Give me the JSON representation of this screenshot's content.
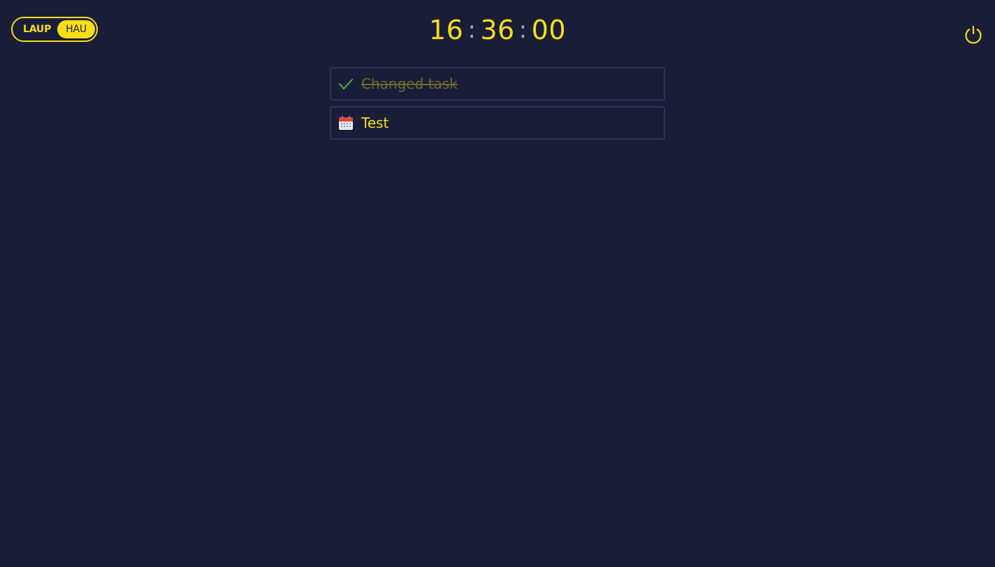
{
  "mode_toggle": {
    "options": [
      {
        "label": "LAUP",
        "active": false
      },
      {
        "label": "HAU",
        "active": true
      }
    ]
  },
  "clock": {
    "hours": "16",
    "minutes": "36",
    "seconds": "00",
    "separator": ":"
  },
  "power": {
    "icon": "power-icon"
  },
  "tasks": [
    {
      "label": "Changed task",
      "status": "done",
      "icon": "checkmark-icon"
    },
    {
      "label": "Test",
      "status": "scheduled",
      "icon": "calendar-icon"
    }
  ],
  "colors": {
    "background": "#1a1d38",
    "accent": "#f6df17",
    "done_text": "#6f6a2a",
    "check": "#4caf50",
    "border": "#2f3357"
  }
}
